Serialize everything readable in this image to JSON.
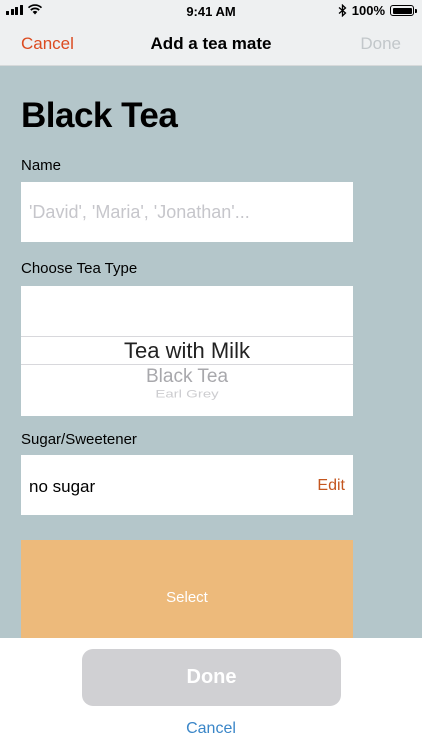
{
  "status_bar": {
    "time": "9:41 AM",
    "battery": "100%",
    "icons": [
      "signal-icon",
      "wifi-icon",
      "bluetooth-icon",
      "battery-icon"
    ]
  },
  "nav": {
    "cancel_label": "Cancel",
    "title": "Add a tea mate",
    "done_label": "Done"
  },
  "page_title": "Black Tea",
  "name_field": {
    "label": "Name",
    "value": "",
    "placeholder": "'David', 'Maria', 'Jonathan'..."
  },
  "tea_type": {
    "label": "Choose Tea Type",
    "options": [
      "Tea with Milk",
      "Black Tea",
      "Earl Grey"
    ],
    "selected": "Tea with Milk"
  },
  "sweetener": {
    "label": "Sugar/Sweetener",
    "value": "no sugar",
    "edit_label": "Edit"
  },
  "select_button_label": "Select",
  "bottom": {
    "done_label": "Done",
    "cancel_label": "Cancel"
  },
  "colors": {
    "accent_orange": "#dc4b20",
    "background": "#b4c6ca",
    "select_button": "#edba7b",
    "done_disabled": "#d0d0d3",
    "cancel_blue": "#3a86c8"
  }
}
